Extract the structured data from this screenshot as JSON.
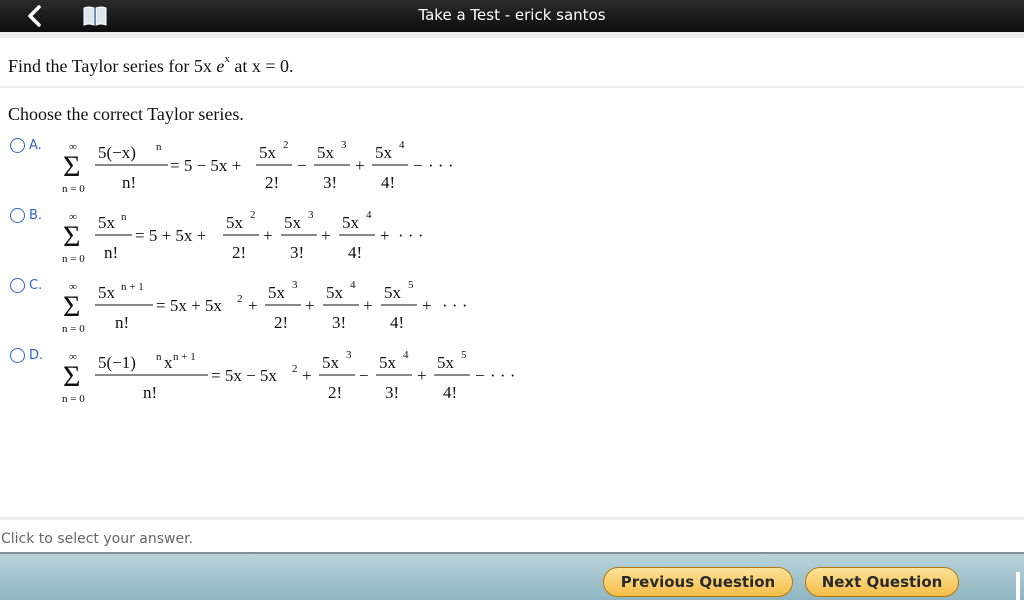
{
  "header": {
    "title": "Take a Test - erick santos",
    "back_icon": "chevron-left-icon",
    "book_icon": "book-icon"
  },
  "question": {
    "prefix": "Find the Taylor series for 5x",
    "func": "e",
    "exponent": "x",
    "suffix": "at x = 0."
  },
  "prompt": "Choose the correct Taylor series.",
  "options": [
    {
      "letter": "A.",
      "upper": "∞",
      "lower": "n = 0",
      "summand_num": "5(−x)",
      "summand_num_sup": "n",
      "summand_den": "n!",
      "eq": "= 5 − 5x +",
      "terms": [
        {
          "num": "5x",
          "sup": "2",
          "den": "2!",
          "op": "−"
        },
        {
          "num": "5x",
          "sup": "3",
          "den": "3!",
          "op": "+"
        },
        {
          "num": "5x",
          "sup": "4",
          "den": "4!",
          "op": "−"
        }
      ],
      "tail": "· · ·"
    },
    {
      "letter": "B.",
      "upper": "∞",
      "lower": "n = 0",
      "summand_num": "5x",
      "summand_num_sup": "n",
      "summand_den": "n!",
      "eq": "= 5 + 5x +",
      "terms": [
        {
          "num": "5x",
          "sup": "2",
          "den": "2!",
          "op": "+"
        },
        {
          "num": "5x",
          "sup": "3",
          "den": "3!",
          "op": "+"
        },
        {
          "num": "5x",
          "sup": "4",
          "den": "4!",
          "op": "+"
        }
      ],
      "tail": "· · ·"
    },
    {
      "letter": "C.",
      "upper": "∞",
      "lower": "n = 0",
      "summand_num": "5x",
      "summand_num_sup": "n + 1",
      "summand_den": "n!",
      "eq": "= 5x + 5x",
      "eq_sup": "2",
      "eq_after": "+",
      "terms": [
        {
          "num": "5x",
          "sup": "3",
          "den": "2!",
          "op": "+"
        },
        {
          "num": "5x",
          "sup": "4",
          "den": "3!",
          "op": "+"
        },
        {
          "num": "5x",
          "sup": "5",
          "den": "4!",
          "op": "+"
        }
      ],
      "tail": "· · ·"
    },
    {
      "letter": "D.",
      "upper": "∞",
      "lower": "n = 0",
      "summand_num": "5(−1)",
      "summand_num_sup": "n",
      "summand_num2": "x",
      "summand_num2_sup": "n + 1",
      "summand_den": "n!",
      "eq": "= 5x − 5x",
      "eq_sup": "2",
      "eq_after": "+",
      "terms": [
        {
          "num": "5x",
          "sup": "3",
          "den": "2!",
          "op": "−"
        },
        {
          "num": "5x",
          "sup": "4",
          "den": "3!",
          "op": "+"
        },
        {
          "num": "5x",
          "sup": "5",
          "den": "4!",
          "op": "−"
        }
      ],
      "tail": "· · ·"
    }
  ],
  "instruction": "Click to select your answer.",
  "buttons": {
    "previous": "Previous Question",
    "next": "Next Question"
  },
  "colors": {
    "accent": "#2f64c6",
    "button": "#f5bd48",
    "topbar": "#1a1a1a"
  }
}
